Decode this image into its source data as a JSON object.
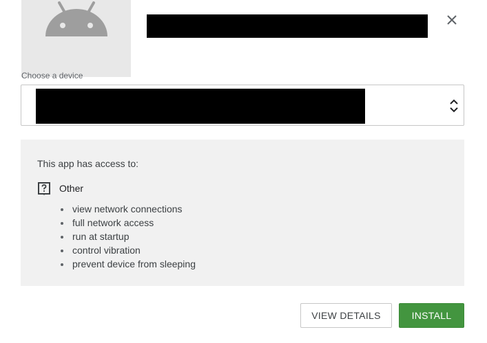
{
  "header": {
    "app_icon": "android-robot-icon",
    "close_icon": "close-icon"
  },
  "device_picker": {
    "label": "Choose a device",
    "arrows_icon": "unfold-arrows-icon"
  },
  "permissions": {
    "heading": "This app has access to:",
    "groups": [
      {
        "icon": "question-box-icon",
        "label": "Other",
        "items": [
          "view network connections",
          "full network access",
          "run at startup",
          "control vibration",
          "prevent device from sleeping"
        ]
      }
    ]
  },
  "actions": {
    "view_details_label": "VIEW DETAILS",
    "install_label": "INSTALL"
  },
  "colors": {
    "install_accent": "#43953f",
    "panel_background": "#f1f1f1",
    "icon_tile": "#e8e8e8",
    "android_icon": "#9e9e9e"
  }
}
